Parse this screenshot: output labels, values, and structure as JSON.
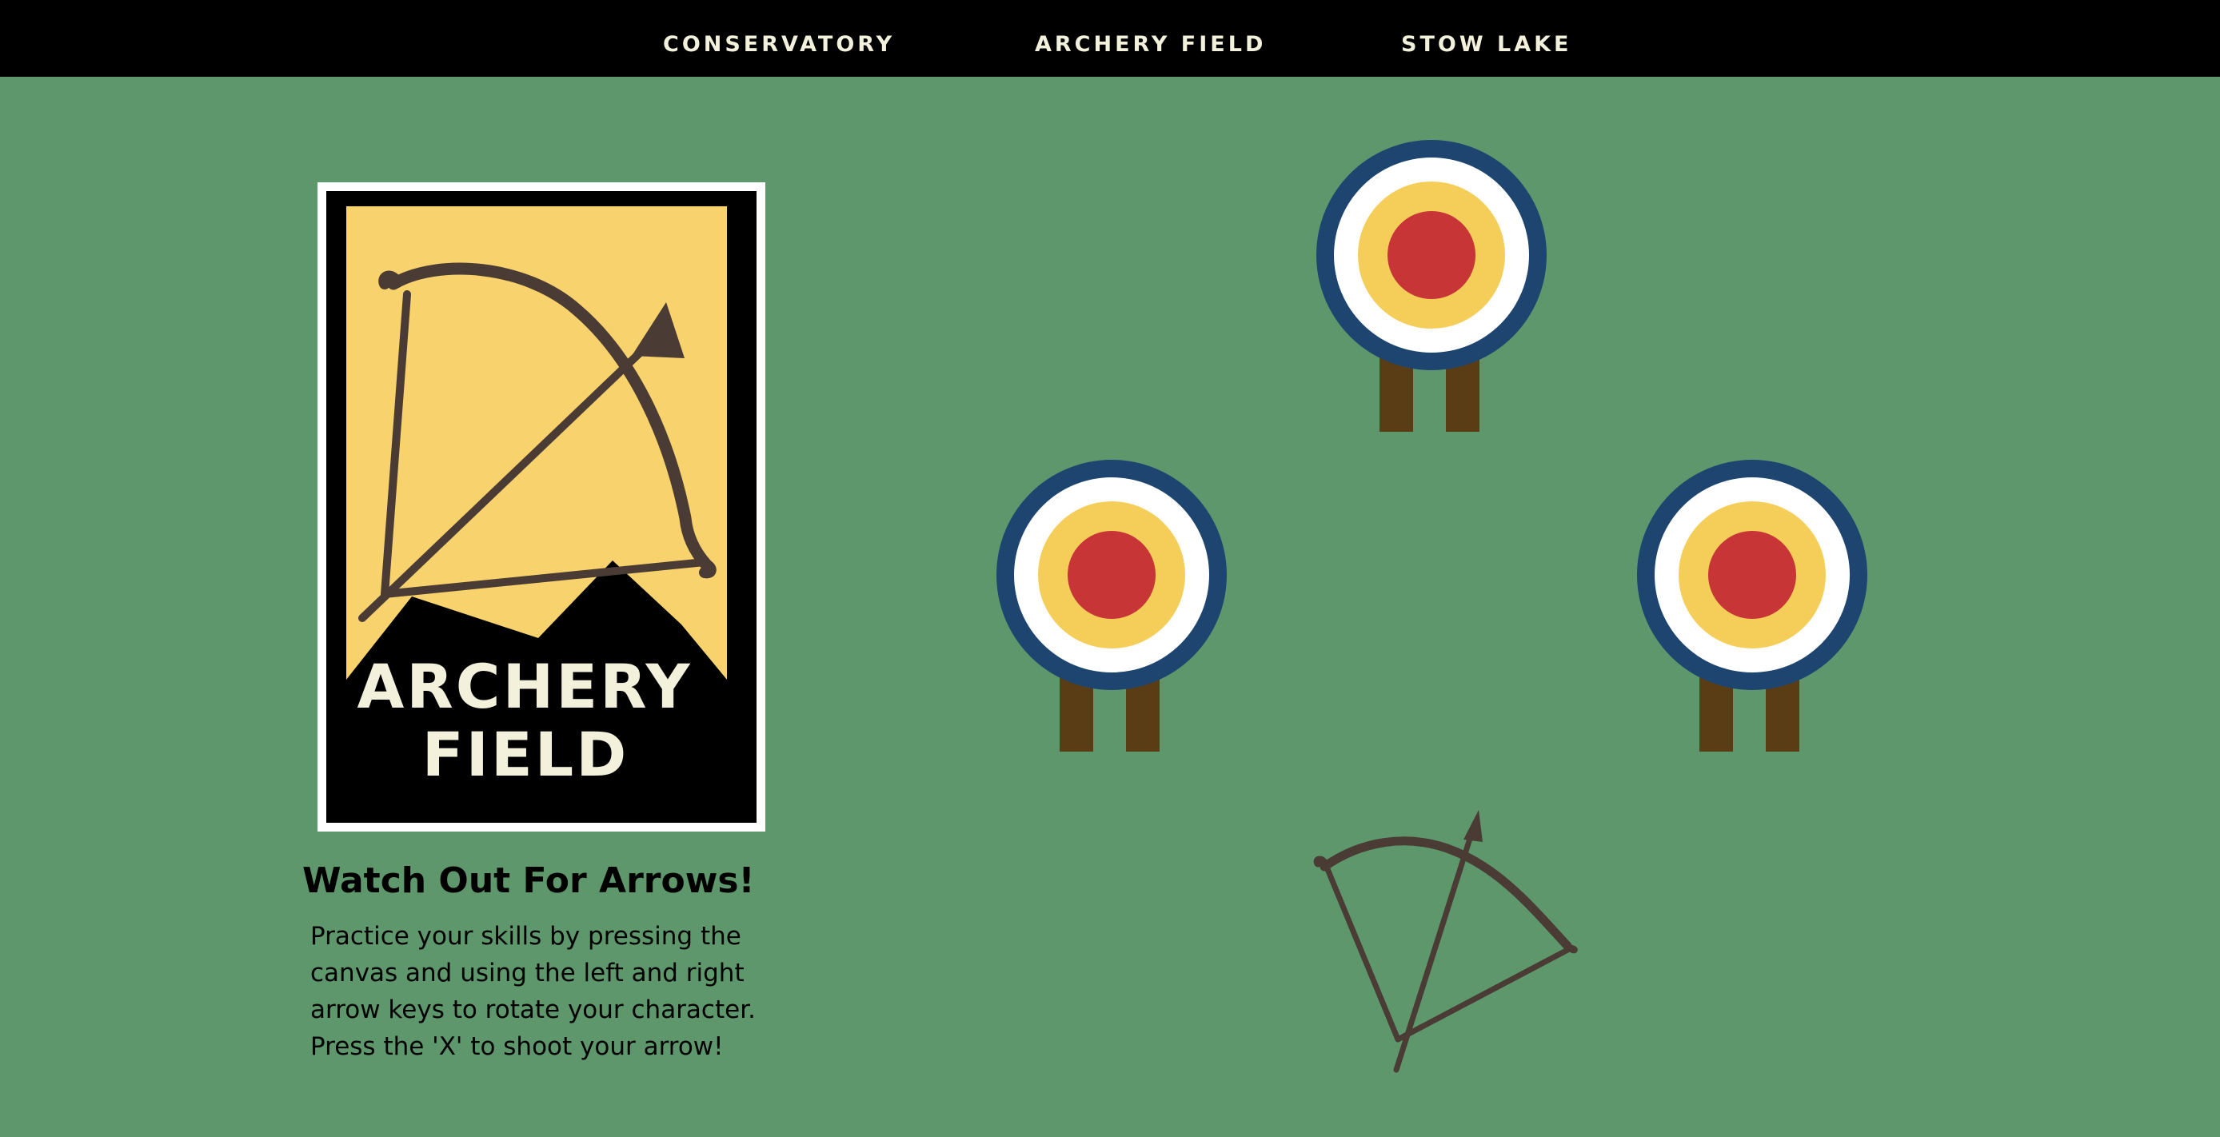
{
  "nav": {
    "items": [
      {
        "label": "CONSERVATORY"
      },
      {
        "label": "ARCHERY FIELD"
      },
      {
        "label": "STOW LAKE"
      }
    ]
  },
  "poster": {
    "line1": "ARCHERY",
    "line2": "FIELD",
    "icon": "bow-and-arrow-icon"
  },
  "info": {
    "heading": "Watch Out For Arrows!",
    "text": "Practice your skills by pressing the canvas and using the left and right arrow keys to rotate your character. Press the 'X' to shoot your arrow!"
  },
  "game": {
    "targets": 3,
    "player": "bow-and-arrow"
  },
  "colors": {
    "background": "#5d976b",
    "nav_bg": "#000000",
    "nav_text": "#f3f0dc",
    "poster_yellow": "#f8d26c",
    "bow": "#4a3b35",
    "target_ring": "#1d4570",
    "target_white": "#ffffff",
    "target_yellow": "#f5ce5a",
    "target_red": "#c73536",
    "target_legs": "#5a3d14"
  }
}
